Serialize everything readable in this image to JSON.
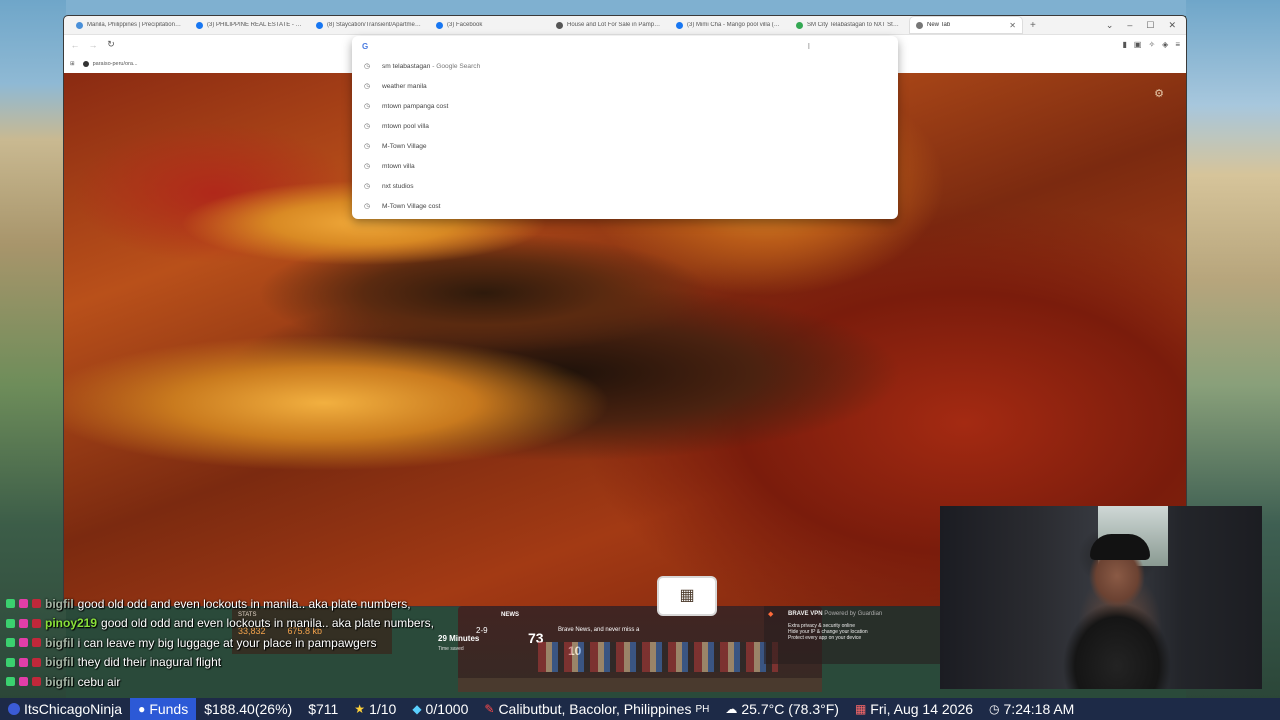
{
  "browser": {
    "tabs": [
      {
        "title": "Manila, Philippines | Precipitation Fo...",
        "favicon_color": "#4a90d9",
        "active": false
      },
      {
        "title": "(3) PHILIPPINE REAL ESTATE - FOR S...",
        "favicon_color": "#1877f2",
        "active": false
      },
      {
        "title": "(8) Staycation/Transient/Apartment ...",
        "favicon_color": "#1877f2",
        "active": false
      },
      {
        "title": "(3) Facebook",
        "favicon_color": "#1877f2",
        "active": false
      },
      {
        "title": "House and Lot For Sale in Pampang...",
        "favicon_color": "#555555",
        "active": false
      },
      {
        "title": "(3) Mimi Cha - Mango pool villa (43...",
        "favicon_color": "#1877f2",
        "active": false
      },
      {
        "title": "SM City Telabastagan to NXT Studio...",
        "favicon_color": "#34a853",
        "active": false
      },
      {
        "title": "New Tab",
        "favicon_color": "#777777",
        "active": true
      }
    ],
    "new_tab_symbol": "+",
    "window_controls": {
      "dropdown": "⌄",
      "minimize": "–",
      "maximize": "☐",
      "close": "✕"
    },
    "tab_close_symbol": "✕",
    "bookmarks": [
      {
        "label": "paraiso-peru/ora..."
      }
    ],
    "omnibox": {
      "engine_icon": "G",
      "value": "",
      "suggestions": [
        {
          "text": "sm telabastagan",
          "desc": " - Google Search"
        },
        {
          "text": "weather manila",
          "desc": ""
        },
        {
          "text": "mtown pampanga cost",
          "desc": ""
        },
        {
          "text": "mtown pool villa",
          "desc": ""
        },
        {
          "text": "M-Town Village",
          "desc": ""
        },
        {
          "text": "mtown villa",
          "desc": ""
        },
        {
          "text": "nxt studios",
          "desc": ""
        },
        {
          "text": "M-Town Village cost",
          "desc": ""
        }
      ]
    }
  },
  "chat": [
    {
      "user": "bigfil",
      "message": "good old odd and even lockouts in manila.. aka plate numbers,"
    },
    {
      "user": "pinoy219",
      "message": "good old odd and even lockouts in manila.. aka plate numbers,"
    },
    {
      "user": "bigfil",
      "message": "i can leave my big luggage at your place in pampawgers"
    },
    {
      "user": "bigfil",
      "message": "they did their inagural flight"
    },
    {
      "user": "bigfil",
      "message": "cebu air"
    }
  ],
  "overlay": {
    "stats_label": "STATS",
    "stats_values": [
      "33,832",
      "675.8 kb"
    ],
    "news_label": "NEWS",
    "news_line": "Brave News, and never miss a",
    "minutes": "29 Minutes",
    "minutes_sub": "Time saved",
    "count_small": "2-9",
    "count_big": "73",
    "count_ten": "10",
    "vpn_title": "BRAVE VPN",
    "vpn_powered": "Powered by Guardian",
    "vpn_lines": [
      "Extra privacy & security online",
      "Hide your IP & change your location",
      "Protect every app on your device"
    ]
  },
  "statusbar": {
    "username": "ItsChicagoNinja",
    "funds_label": "Funds",
    "balance": "$188.40(26%)",
    "amount2": "$711",
    "stars": "1/10",
    "diamonds": "0/1000",
    "location": "Calibutbut, Bacolor, Philippines",
    "country": "PH",
    "weather": "25.7°C (78.3°F)",
    "date": "Fri, Aug 14 2026",
    "time": "7:24:18 AM"
  }
}
